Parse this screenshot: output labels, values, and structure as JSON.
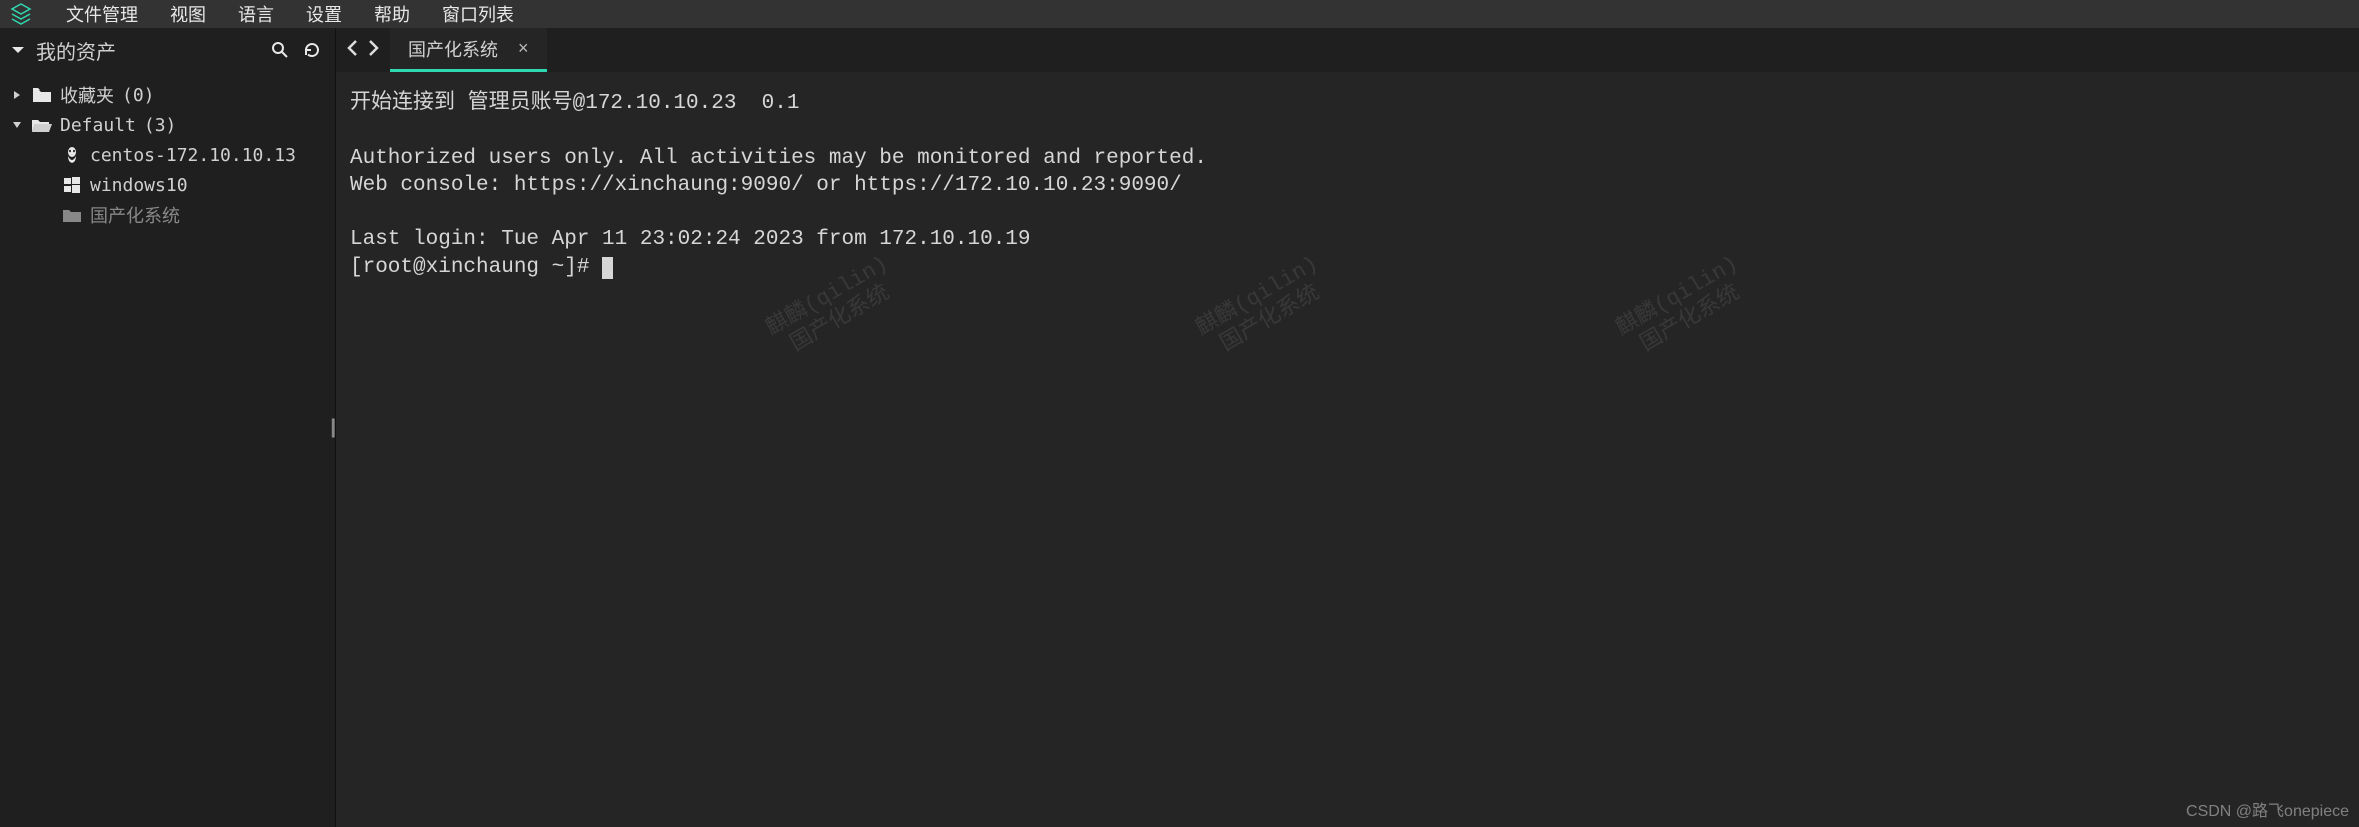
{
  "menubar": {
    "items": [
      "文件管理",
      "视图",
      "语言",
      "设置",
      "帮助",
      "窗口列表"
    ]
  },
  "sidebar": {
    "title": "我的资产",
    "tree": {
      "favorites": {
        "label": "收藏夹",
        "count": "(0)"
      },
      "default": {
        "label": "Default",
        "count": "(3)"
      },
      "nodes": [
        {
          "label": "centos-172.10.10.13",
          "iconName": "linux-icon"
        },
        {
          "label": "windows10",
          "iconName": "windows-icon"
        },
        {
          "label": "国产化系统",
          "iconName": "folder-icon",
          "muted": true
        }
      ]
    }
  },
  "tab": {
    "title": "国产化系统",
    "close": "×"
  },
  "terminal": {
    "line1_a": "开始连接到 管理员账号",
    "line1_b": "@172.10.10.23",
    "line1_c": "  0.1",
    "line3": "Authorized users only. All activities may be monitored and reported.",
    "line4": "Web console: https://xinchaung:9090/ or https://172.10.10.23:9090/",
    "line6": "Last login: Tue Apr 11 23:02:24 2023 from 172.10.10.19",
    "prompt": "[root@xinchaung ~]# "
  },
  "watermark": "麒麟(qilin)\n国产化系统",
  "csdn": "CSDN @路飞onepiece"
}
